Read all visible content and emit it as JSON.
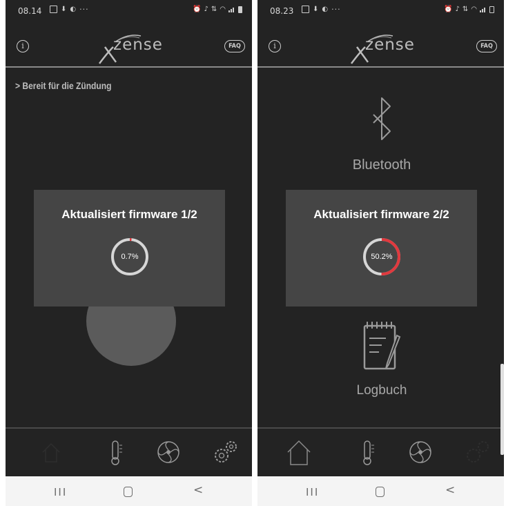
{
  "screens": [
    {
      "status": {
        "time": "08.14"
      },
      "header": {
        "logo_text": "zense",
        "info_label": "i",
        "faq_label": "FAQ"
      },
      "breadcrumb": "> Bereit für die Zündung",
      "dialog": {
        "title": "Aktualisiert firmware 1/2",
        "progress_text": "0.7%",
        "progress": 0.007
      },
      "tabs": [
        "home-icon",
        "thermometer-icon",
        "fan-icon",
        "gears-icon"
      ],
      "navbar": {
        "recent": "III",
        "back": "<"
      }
    },
    {
      "status": {
        "time": "08.23"
      },
      "header": {
        "logo_text": "zense",
        "info_label": "i",
        "faq_label": "FAQ"
      },
      "menu": {
        "bluetooth_label": "Bluetooth",
        "logbook_label": "Logbuch"
      },
      "dialog": {
        "title": "Aktualisiert firmware 2/2",
        "progress_text": "50.2%",
        "progress": 0.502
      },
      "tabs": [
        "home-icon",
        "thermometer-icon",
        "fan-icon",
        "gears-icon"
      ],
      "navbar": {
        "recent": "III",
        "back": "<"
      }
    }
  ],
  "colors": {
    "background": "#232323",
    "dialog": "#454545",
    "progress_track": "#d6d6d6",
    "progress_fill": "#e0393e",
    "text_muted": "#a8a8a8"
  }
}
